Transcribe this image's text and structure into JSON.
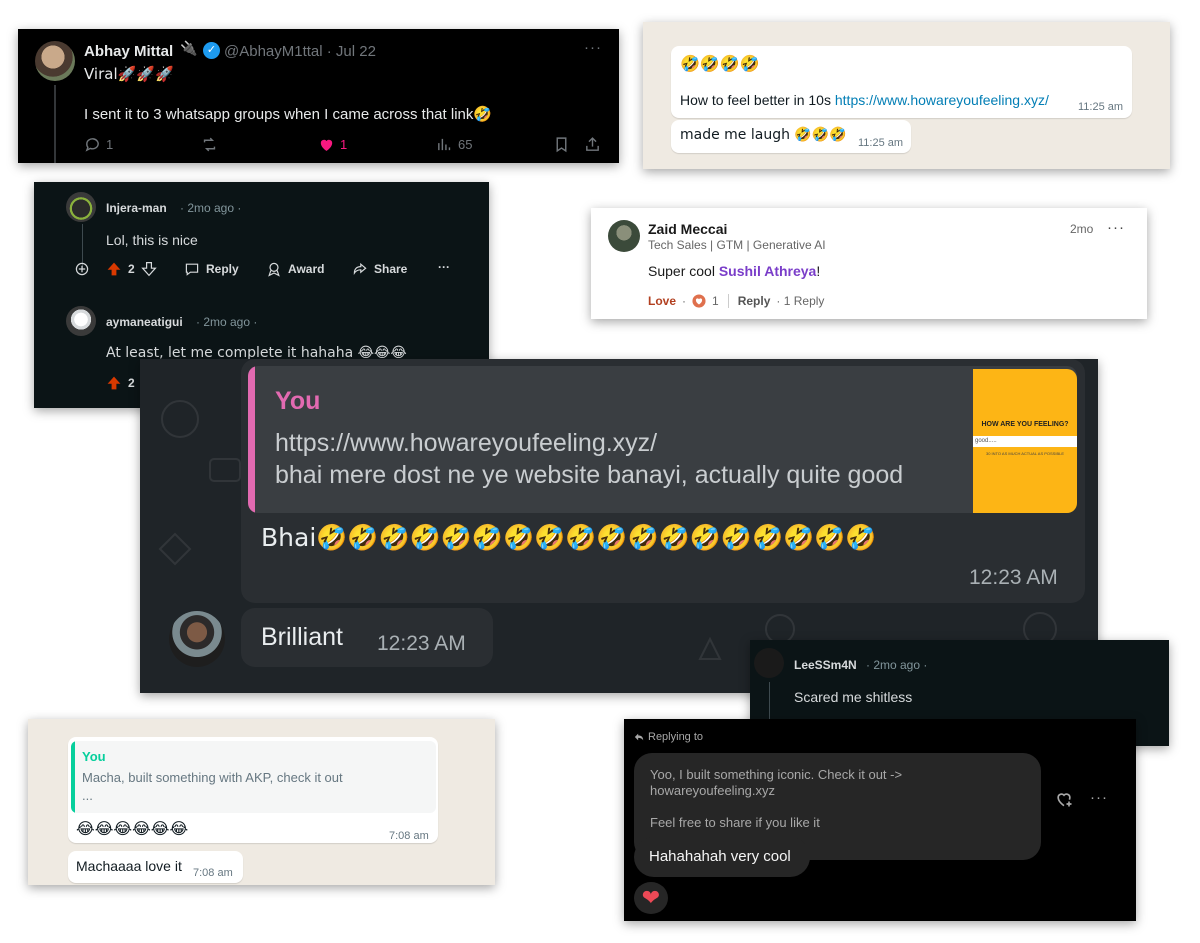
{
  "twitter": {
    "name": "Abhay Mittal",
    "plug_emoji": "🔌",
    "verified_mark": "✓",
    "handle_date": "@AbhayM1ttal · Jul 22",
    "more": "···",
    "line1": "Viral🚀🚀🚀",
    "line2": "I sent it to 3 whatsapp groups when I came across that link🤣",
    "replies": "1",
    "likes": "1",
    "views": "65",
    "like_color": "#f91880"
  },
  "wa_top": {
    "emojis": "🤣🤣🤣🤣",
    "msg_text": "How to feel better in 10s ",
    "msg_link": "https://www.howareyoufeeling.xyz/",
    "msg_time": "11:25 am",
    "msg2_text": "made me laugh 🤣🤣🤣",
    "msg2_time": "11:25 am"
  },
  "reddit": {
    "c1_user": "Injera-man",
    "c1_meta": "· 2mo ago ·",
    "c1_body": "Lol, this is nice",
    "c1_votes": "2",
    "c2_user": "aymaneatigui",
    "c2_meta": "· 2mo ago ·",
    "c2_body": "At least, let me complete it hahaha 😂😂😂",
    "c2_votes": "2",
    "reply": "Reply",
    "award": "Award",
    "share": "Share",
    "more": "···",
    "upvote_color": "#d93900"
  },
  "linkedin": {
    "name": "Zaid Meccai",
    "headline": "Tech Sales | GTM | Generative AI",
    "time": "2mo",
    "more": "···",
    "text_prefix": "Super cool ",
    "mention": "Sushil Athreya",
    "text_suffix": "!",
    "love": "Love",
    "dot": "·",
    "reaction_count": "1",
    "reply": "Reply",
    "reply_count": "· 1 Reply"
  },
  "wa_dark": {
    "quote_author": "You",
    "quote_link": "https://www.howareyoufeeling.xyz/",
    "quote_text": "bhai mere dost ne ye website banayi, actually quite good",
    "thumb_title": "HOW ARE YOU FEELING?",
    "thumb_input": "good.....",
    "thumb_sub": "30 INTO AS MUCH ACTUAL AS POSSIBLE",
    "message": "Bhai🤣🤣🤣🤣🤣🤣🤣🤣🤣🤣🤣🤣🤣🤣🤣🤣🤣🤣",
    "time": "12:23 AM",
    "reply_text": "Brilliant",
    "reply_time": "12:23 AM"
  },
  "lee": {
    "user": "LeeSSm4N",
    "meta": "· 2mo ago ·",
    "body": "Scared me shitless"
  },
  "wa_bottom": {
    "quote_author": "You",
    "quote_text": "Macha, built something with AKP, check it out",
    "quote_more": "...",
    "emojis": "😂😂😂😂😂😂",
    "time1": "7:08 am",
    "msg2": "Machaaaa love it",
    "time2": "7:08 am"
  },
  "instagram": {
    "replying_to": "Replying to",
    "quoted_line1": "Yoo, I built something iconic. Check it out ->",
    "quoted_line2": "howareyoufeeling.xyz",
    "quoted_line3": "Feel free to share if you like it",
    "reply": "Hahahahah very cool",
    "heart": "❤",
    "more": "···"
  }
}
